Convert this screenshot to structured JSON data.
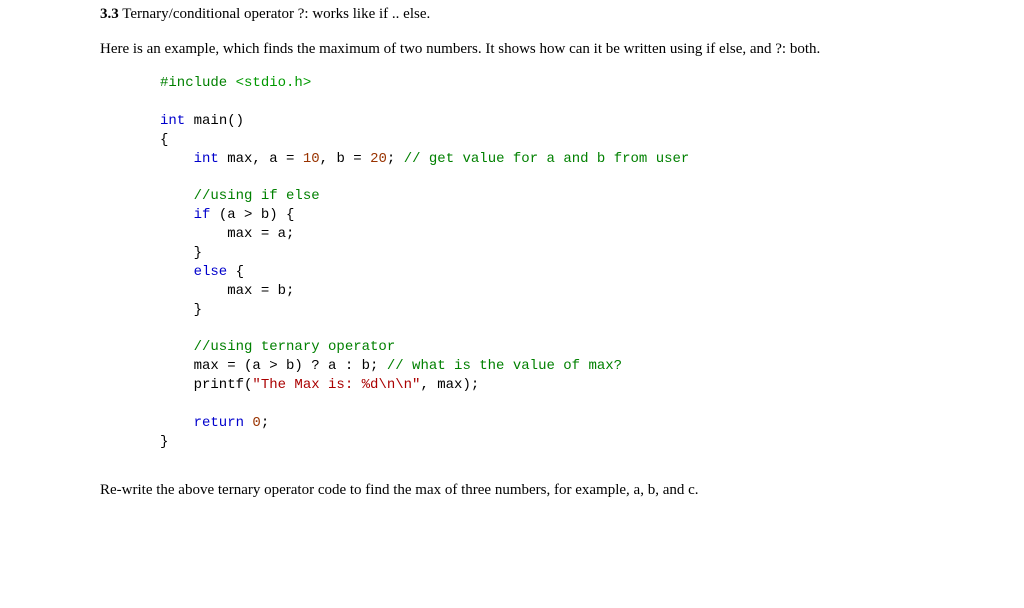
{
  "heading": {
    "number": "3.3",
    "text": " Ternary/conditional operator ?: works like if .. else."
  },
  "intro": "Here is an example, which finds the maximum of two numbers. It shows how can it be written using if else, and ?: both.",
  "code": {
    "l1_include": "#include ",
    "l1_header": "<stdio.h>",
    "l2_int": "int",
    "l2_main": " main()",
    "l3_brace": "{",
    "l4_int": "    int",
    "l4_maxa": " max, a = ",
    "l4_ten": "10",
    "l4_b": ", b = ",
    "l4_twenty": "20",
    "l4_semi": "; ",
    "l4_comment": "// get value for a and b from user",
    "l5_comment": "    //using if else",
    "l6_if": "    if",
    "l6_cond": " (a > b) {",
    "l7_max": "        max = a;",
    "l8_brace": "    }",
    "l9_else": "    else",
    "l9_brace": " {",
    "l10_max": "        max = b;",
    "l11_brace": "    }",
    "l12_comment": "    //using ternary operator",
    "l13_expr": "    max = (a > b) ? a : b; ",
    "l13_comment": "// what is the value of max?",
    "l14_printf": "    printf(",
    "l14_string": "\"The Max is: %d\\n\\n\"",
    "l14_rest": ", max);",
    "l15_return": "    return",
    "l15_zero": " 0",
    "l15_semi": ";",
    "l16_brace": "}"
  },
  "closing": "Re-write the above ternary operator code to find the max of three numbers, for example, a, b, and c."
}
